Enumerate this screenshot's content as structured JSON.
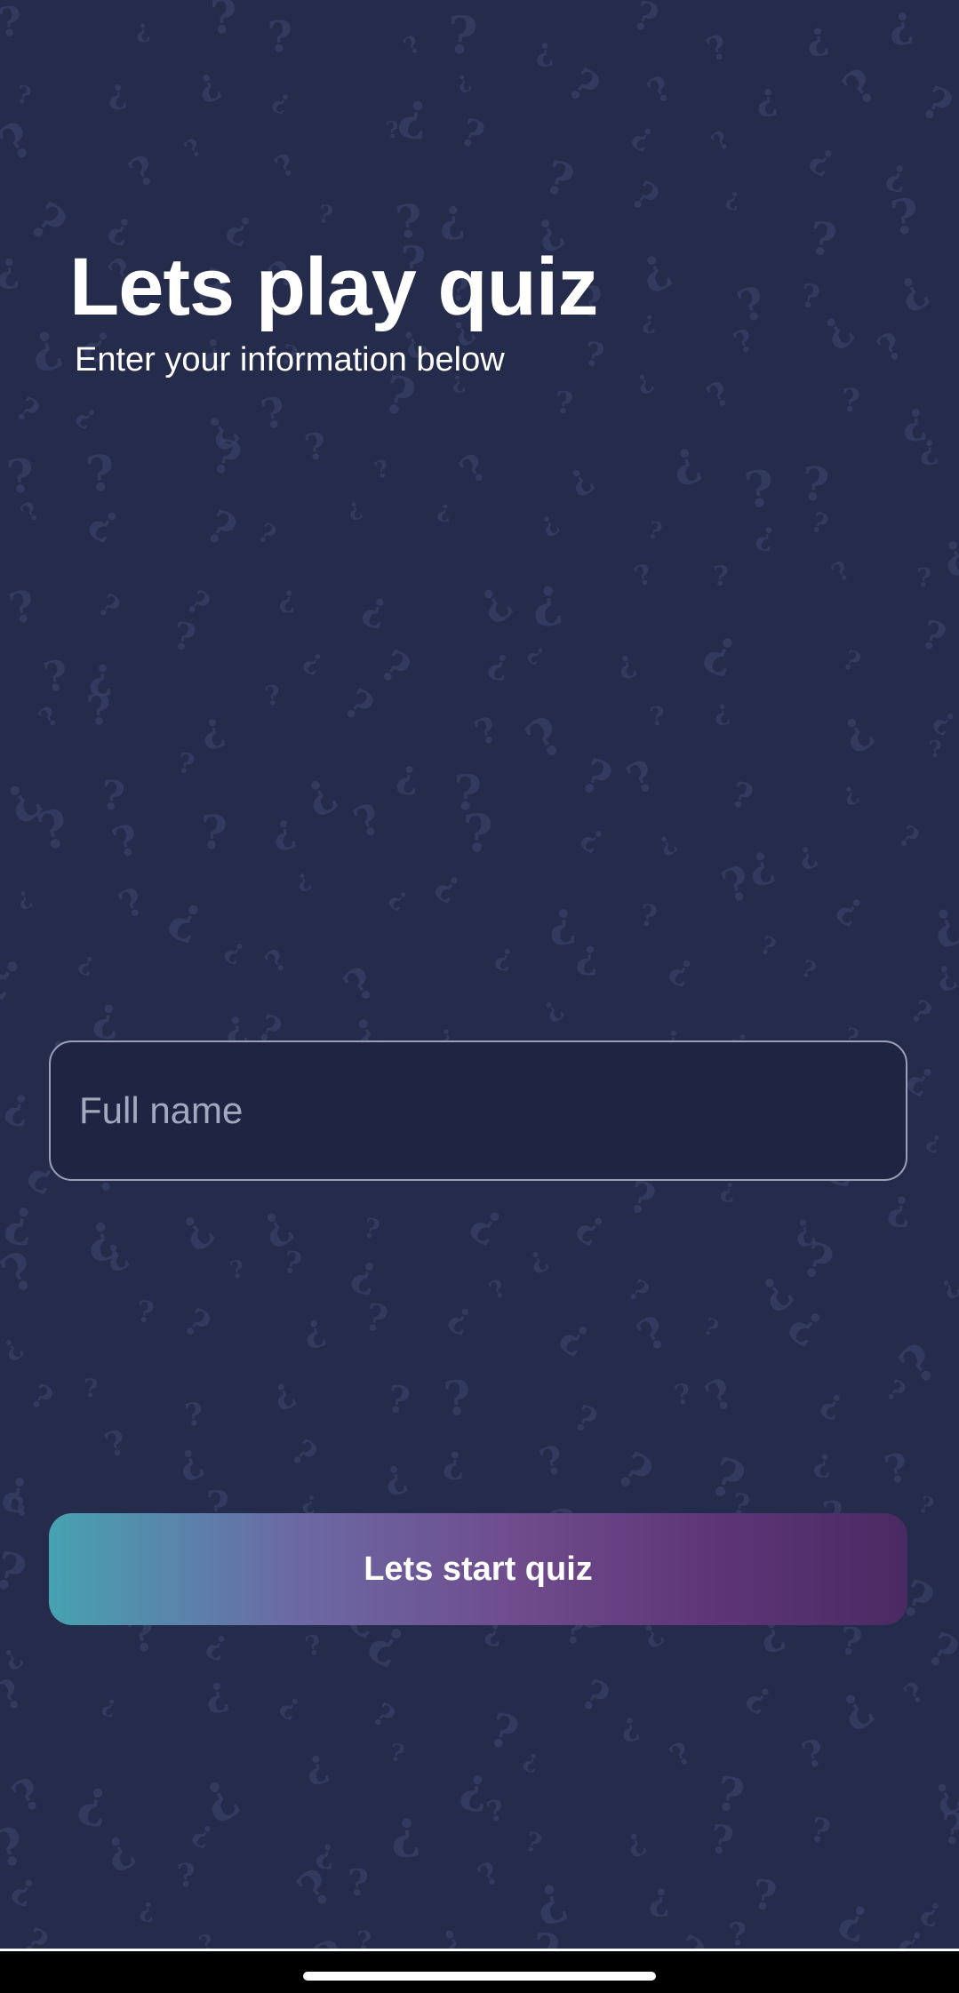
{
  "header": {
    "title": "Lets play quiz",
    "subtitle": "Enter your information below"
  },
  "form": {
    "name_placeholder": "Full name",
    "name_value": ""
  },
  "actions": {
    "start_label": "Lets start quiz"
  },
  "theme": {
    "background": "#252b4a",
    "field_background": "#1e2442",
    "button_gradient_start": "#46a2b1",
    "button_gradient_end": "#4a2a62",
    "text": "#ffffff"
  },
  "background_pattern": {
    "icon": "question-mark-icon",
    "glyph": "?"
  }
}
